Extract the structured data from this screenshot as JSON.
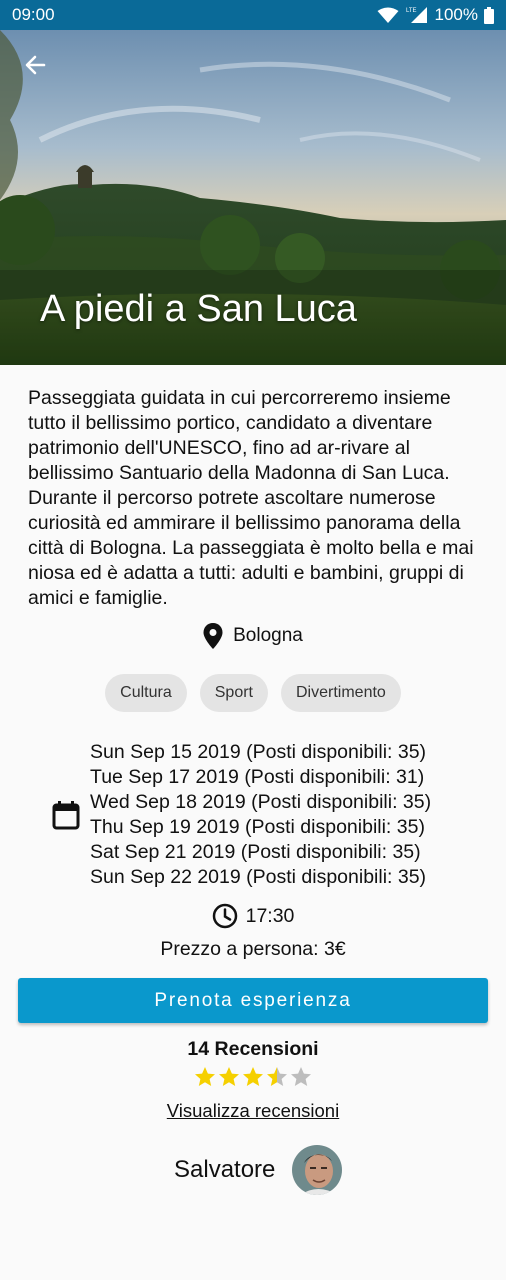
{
  "status_bar": {
    "time": "09:00",
    "network": "LTE",
    "battery": "100%",
    "icons": [
      "wifi-icon",
      "signal-icon",
      "battery-icon"
    ]
  },
  "hero": {
    "title": "A piedi a San Luca",
    "back_icon": "arrow-back-icon"
  },
  "description": "Passeggiata guidata in cui percorreremo insieme tutto il bellissimo portico, candidato a diventare patrimonio dell'UNESCO, fino ad ar-rivare al bellissimo Santuario della Madonna di San Luca. Durante il percorso potrete ascoltare numerose curiosità ed ammirare il bellissimo panorama della città di Bologna. La passeggiata è molto bella e mai niosa ed è adatta a tutti: adulti e bambini, gruppi di amici e famiglie.",
  "location": {
    "icon": "location-pin-icon",
    "city": "Bologna"
  },
  "tags": [
    "Cultura",
    "Sport",
    "Divertimento"
  ],
  "dates": {
    "icon": "calendar-icon",
    "items": [
      "Sun Sep 15 2019 (Posti disponibili: 35)",
      "Tue Sep 17 2019 (Posti disponibili: 31)",
      "Wed Sep 18 2019 (Posti disponibili: 35)",
      "Thu Sep 19 2019 (Posti disponibili: 35)",
      "Sat Sep 21 2019 (Posti disponibili: 35)",
      "Sun Sep 22 2019 (Posti disponibili: 35)"
    ]
  },
  "time": {
    "icon": "clock-icon",
    "value": "17:30"
  },
  "price": "Prezzo a persona: 3€",
  "book_button": "Prenota esperienza",
  "reviews": {
    "title": "14 Recensioni",
    "rating": 3.5,
    "max": 5,
    "link": "Visualizza recensioni"
  },
  "host": {
    "name": "Salvatore"
  },
  "colors": {
    "status_bar": "#0a6a98",
    "accent": "#0a98cc",
    "star": "#f5d000",
    "star_empty": "#bdbdbd"
  }
}
